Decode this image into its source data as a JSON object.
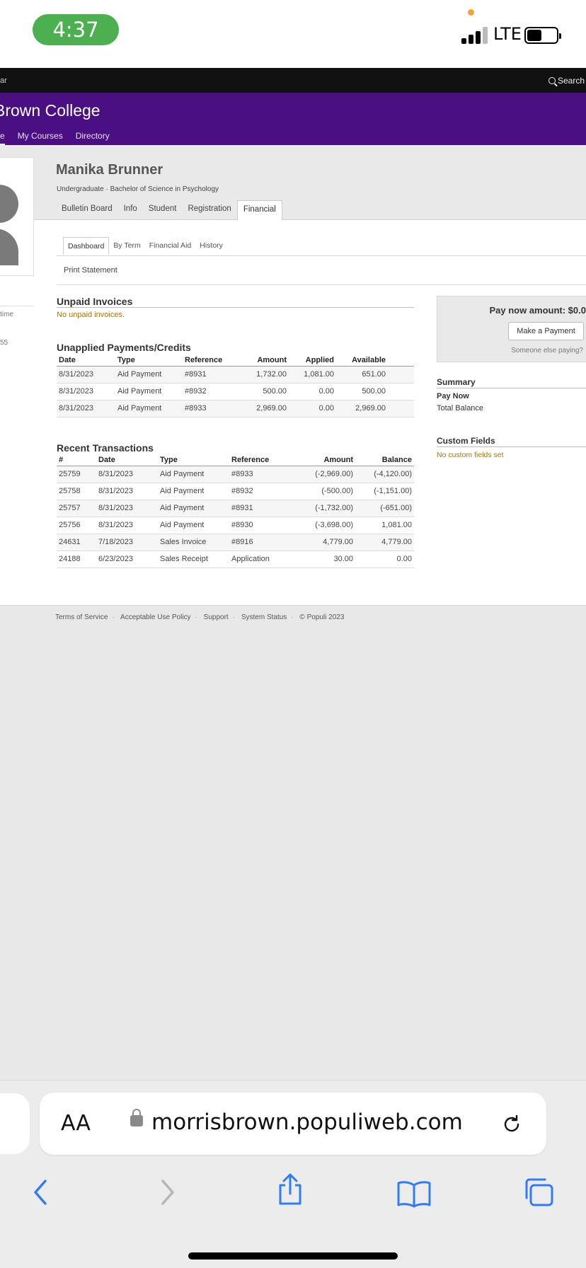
{
  "status_bar": {
    "time": "4:37",
    "network": "LTE"
  },
  "topbar": {
    "left_fragment": "ar",
    "search_label": "Search"
  },
  "header": {
    "college": "Brown College",
    "nav": [
      "e",
      "My Courses",
      "Directory"
    ]
  },
  "profile": {
    "name": "Manika Brunner",
    "program": "Undergraduate · Bachelor of Science in Psychology",
    "tabs": [
      "Bulletin Board",
      "Info",
      "Student",
      "Registration",
      "Financial"
    ],
    "active_tab": "Financial"
  },
  "financial": {
    "subtabs": [
      "Dashboard",
      "By Term",
      "Financial Aid",
      "History"
    ],
    "print_label": "Print Statement",
    "side_fragments": [
      "time",
      "55"
    ]
  },
  "unpaid": {
    "title": "Unpaid Invoices",
    "empty": "No unpaid invoices."
  },
  "unapplied": {
    "title": "Unapplied Payments/Credits",
    "columns": [
      "Date",
      "Type",
      "Reference",
      "Amount",
      "Applied",
      "Available"
    ],
    "rows": [
      [
        "8/31/2023",
        "Aid Payment",
        "#8931",
        "1,732.00",
        "1,081.00",
        "651.00"
      ],
      [
        "8/31/2023",
        "Aid Payment",
        "#8932",
        "500.00",
        "0.00",
        "500.00"
      ],
      [
        "8/31/2023",
        "Aid Payment",
        "#8933",
        "2,969.00",
        "0.00",
        "2,969.00"
      ]
    ]
  },
  "recent": {
    "title": "Recent Transactions",
    "columns": [
      "#",
      "Date",
      "Type",
      "Reference",
      "Amount",
      "Balance"
    ],
    "rows": [
      [
        "25759",
        "8/31/2023",
        "Aid Payment",
        "#8933",
        "(-2,969.00)",
        "(-4,120.00)"
      ],
      [
        "25758",
        "8/31/2023",
        "Aid Payment",
        "#8932",
        "(-500.00)",
        "(-1,151.00)"
      ],
      [
        "25757",
        "8/31/2023",
        "Aid Payment",
        "#8931",
        "(-1,732.00)",
        "(-651.00)"
      ],
      [
        "25756",
        "8/31/2023",
        "Aid Payment",
        "#8930",
        "(-3,698.00)",
        "1,081.00"
      ],
      [
        "24631",
        "7/18/2023",
        "Sales Invoice",
        "#8916",
        "4,779.00",
        "4,779.00"
      ],
      [
        "24188",
        "6/23/2023",
        "Sales Receipt",
        "Application",
        "30.00",
        "0.00"
      ]
    ]
  },
  "pay": {
    "amount_label": "Pay now amount: $0.0",
    "button": "Make a Payment",
    "someone_else": "Someone else paying?"
  },
  "summary": {
    "title": "Summary",
    "pay_now": "Pay Now",
    "total_balance": "Total Balance"
  },
  "custom_fields": {
    "title": "Custom Fields",
    "empty": "No custom fields set"
  },
  "footer": [
    "Terms of Service",
    "Acceptable Use Policy",
    "Support",
    "System Status",
    "© Populi 2023"
  ],
  "safari": {
    "aa": "AA",
    "url": "morrisbrown.populiweb.com"
  },
  "colors": {
    "brand": "#4b0f84",
    "negative": "#c62828",
    "link": "#1e4fb3",
    "gold": "#a8760d"
  }
}
